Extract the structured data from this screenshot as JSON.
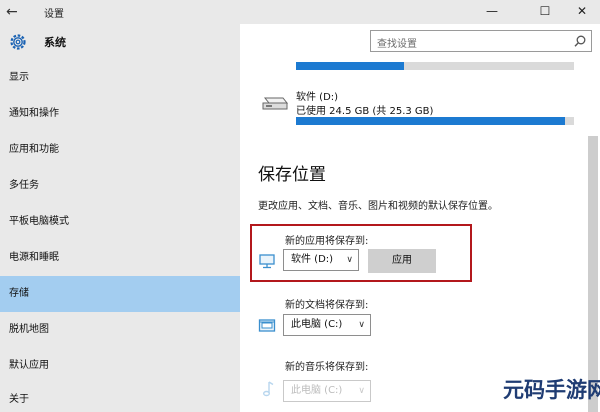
{
  "window": {
    "title": "设置"
  },
  "sidebar": {
    "header": "系统",
    "items": [
      {
        "label": "显示"
      },
      {
        "label": "通知和操作"
      },
      {
        "label": "应用和功能"
      },
      {
        "label": "多任务"
      },
      {
        "label": "平板电脑模式"
      },
      {
        "label": "电源和睡眠"
      },
      {
        "label": "存储"
      },
      {
        "label": "脱机地图"
      },
      {
        "label": "默认应用"
      },
      {
        "label": "关于"
      }
    ],
    "selected_index": 6,
    "selected_color": "#a3cdf0"
  },
  "search": {
    "placeholder": "查找设置"
  },
  "drives": [
    {
      "usage_fraction": 0.39
    },
    {
      "name": "软件 (D:)",
      "usage_text": "已使用 24.5 GB (共 25.3 GB)",
      "usage_fraction": 0.968
    }
  ],
  "save_locations": {
    "title": "保存位置",
    "description": "更改应用、文档、音乐、图片和视频的默认保存位置。",
    "apps": {
      "label": "新的应用将保存到:",
      "value": "软件 (D:)",
      "apply_label": "应用"
    },
    "documents": {
      "label": "新的文档将保存到:",
      "value": "此电脑 (C:)"
    },
    "music": {
      "label": "新的音乐将保存到:",
      "value": "此电脑 (C:)"
    }
  },
  "watermark": "元码手游网",
  "colors": {
    "accent": "#1c7ad1",
    "highlight_border": "#b3181c",
    "title_bar": "#e9e9e9"
  }
}
